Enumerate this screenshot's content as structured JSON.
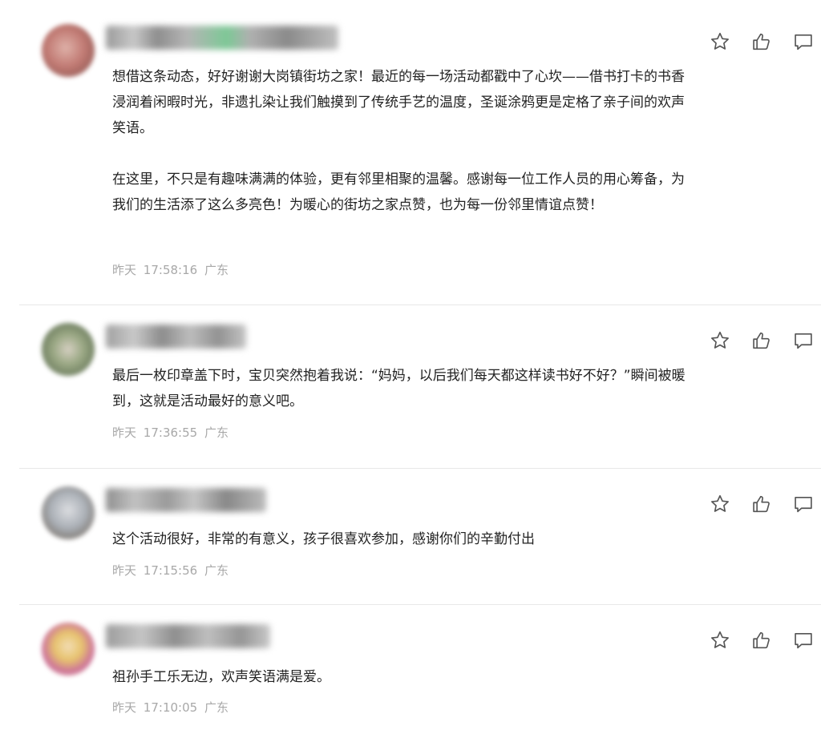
{
  "comments": [
    {
      "paragraphs": [
        "想借这条动态，好好谢谢大岗镇街坊之家！最近的每一场活动都戳中了心坎——借书打卡的书香浸润着闲暇时光，非遗扎染让我们触摸到了传统手艺的温度，圣诞涂鸦更是定格了亲子间的欢声笑语。",
        "在这里，不只是有趣味满满的体验，更有邻里相聚的温馨。感谢每一位工作人员的用心筹备，为我们的生活添了这么多亮色！为暖心的街坊之家点赞，也为每一份邻里情谊点赞！"
      ],
      "day": "昨天",
      "time": "17:58:16",
      "location": "广东"
    },
    {
      "paragraphs": [
        "最后一枚印章盖下时，宝贝突然抱着我说：“妈妈，以后我们每天都这样读书好不好？”瞬间被暖到，这就是活动最好的意义吧。"
      ],
      "day": "昨天",
      "time": "17:36:55",
      "location": "广东"
    },
    {
      "paragraphs": [
        "这个活动很好，非常的有意义，孩子很喜欢参加，感谢你们的辛勤付出"
      ],
      "day": "昨天",
      "time": "17:15:56",
      "location": "广东"
    },
    {
      "paragraphs": [
        "祖孙手工乐无边，欢声笑语满是爱。"
      ],
      "day": "昨天",
      "time": "17:10:05",
      "location": "广东"
    }
  ],
  "icons": {
    "star": "star-icon",
    "like": "thumbs-up-icon",
    "reply": "comment-icon"
  },
  "colors": {
    "text": "#222222",
    "meta": "#a8a8a8",
    "icon": "#555555",
    "divider": "#e8e8e8"
  }
}
